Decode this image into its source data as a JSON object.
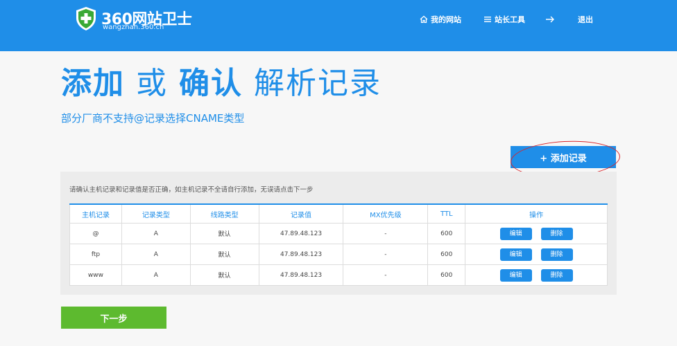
{
  "colors": {
    "brand": "#1f8ee8",
    "next_button": "#5dba2f",
    "annotation": "#d9252a"
  },
  "header": {
    "logo_title": "360网站卫士",
    "logo_sub": "wangzhan.360.cn",
    "nav": [
      {
        "icon": "home-icon",
        "label": "我的网站"
      },
      {
        "icon": "menu-icon",
        "label": "站长工具"
      },
      {
        "icon": "arrow-right-icon",
        "label": ""
      },
      {
        "icon": "",
        "label": "退出"
      }
    ]
  },
  "page": {
    "title_part1": "添加",
    "title_part2": "或",
    "title_part3": "确认",
    "title_part4": "解析记录",
    "subtitle": "部分厂商不支持@记录选择CNAME类型",
    "add_button": "+ 添加记录",
    "note": "请确认主机记录和记录值是否正确，如主机记录不全请自行添加，无误请点击下一步",
    "next_button": "下一步"
  },
  "table": {
    "headers": [
      "主机记录",
      "记录类型",
      "线路类型",
      "记录值",
      "MX优先级",
      "TTL",
      "操作"
    ],
    "rows": [
      {
        "host": "@",
        "type": "A",
        "line": "默认",
        "value": "47.89.48.123",
        "mx": "-",
        "ttl": "600",
        "edit": "编辑",
        "delete": "删除"
      },
      {
        "host": "ftp",
        "type": "A",
        "line": "默认",
        "value": "47.89.48.123",
        "mx": "-",
        "ttl": "600",
        "edit": "编辑",
        "delete": "删除"
      },
      {
        "host": "www",
        "type": "A",
        "line": "默认",
        "value": "47.89.48.123",
        "mx": "-",
        "ttl": "600",
        "edit": "编辑",
        "delete": "删除"
      }
    ]
  }
}
